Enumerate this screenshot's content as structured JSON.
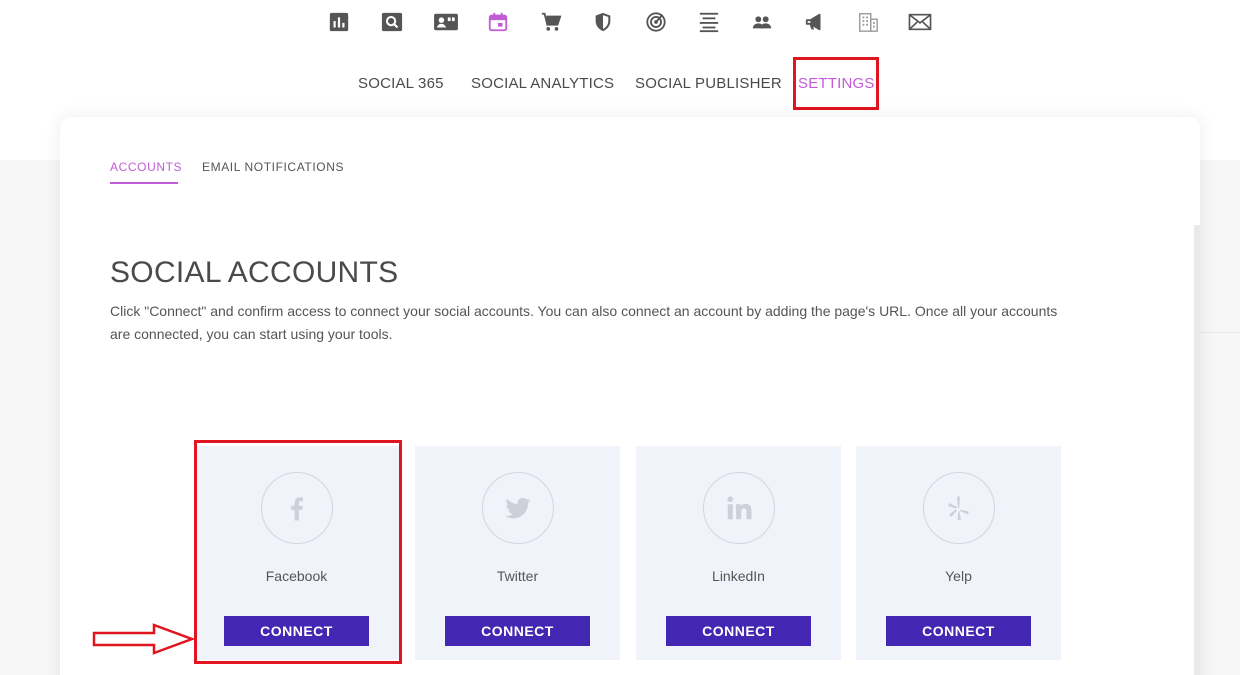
{
  "top_icons": [
    {
      "name": "reports-icon"
    },
    {
      "name": "search-icon"
    },
    {
      "name": "reviews-icon"
    },
    {
      "name": "calendar-icon"
    },
    {
      "name": "cart-icon"
    },
    {
      "name": "shield-icon"
    },
    {
      "name": "target-icon"
    },
    {
      "name": "listings-icon"
    },
    {
      "name": "people-icon"
    },
    {
      "name": "megaphone-icon"
    },
    {
      "name": "building-icon"
    },
    {
      "name": "mail-icon"
    }
  ],
  "colors": {
    "accent": "#c15cd6",
    "button": "#4326b2",
    "annotation": "#e0151f",
    "tile_bg": "#f0f3f9"
  },
  "nav": {
    "items": [
      {
        "label": "SOCIAL 365"
      },
      {
        "label": "SOCIAL ANALYTICS"
      },
      {
        "label": "SOCIAL PUBLISHER"
      },
      {
        "label": "SETTINGS",
        "active": true
      }
    ]
  },
  "subtabs": [
    {
      "label": "ACCOUNTS",
      "active": true
    },
    {
      "label": "EMAIL NOTIFICATIONS"
    }
  ],
  "content": {
    "title": "SOCIAL ACCOUNTS",
    "description": "Click \"Connect\" and confirm access to connect your social accounts. You can also connect an account by adding the page's URL. Once all your accounts are connected, you can start using your tools."
  },
  "accounts": [
    {
      "name": "Facebook",
      "button": "CONNECT",
      "icon": "facebook-icon"
    },
    {
      "name": "Twitter",
      "button": "CONNECT",
      "icon": "twitter-icon"
    },
    {
      "name": "LinkedIn",
      "button": "CONNECT",
      "icon": "linkedin-icon"
    },
    {
      "name": "Yelp",
      "button": "CONNECT",
      "icon": "yelp-icon"
    }
  ]
}
